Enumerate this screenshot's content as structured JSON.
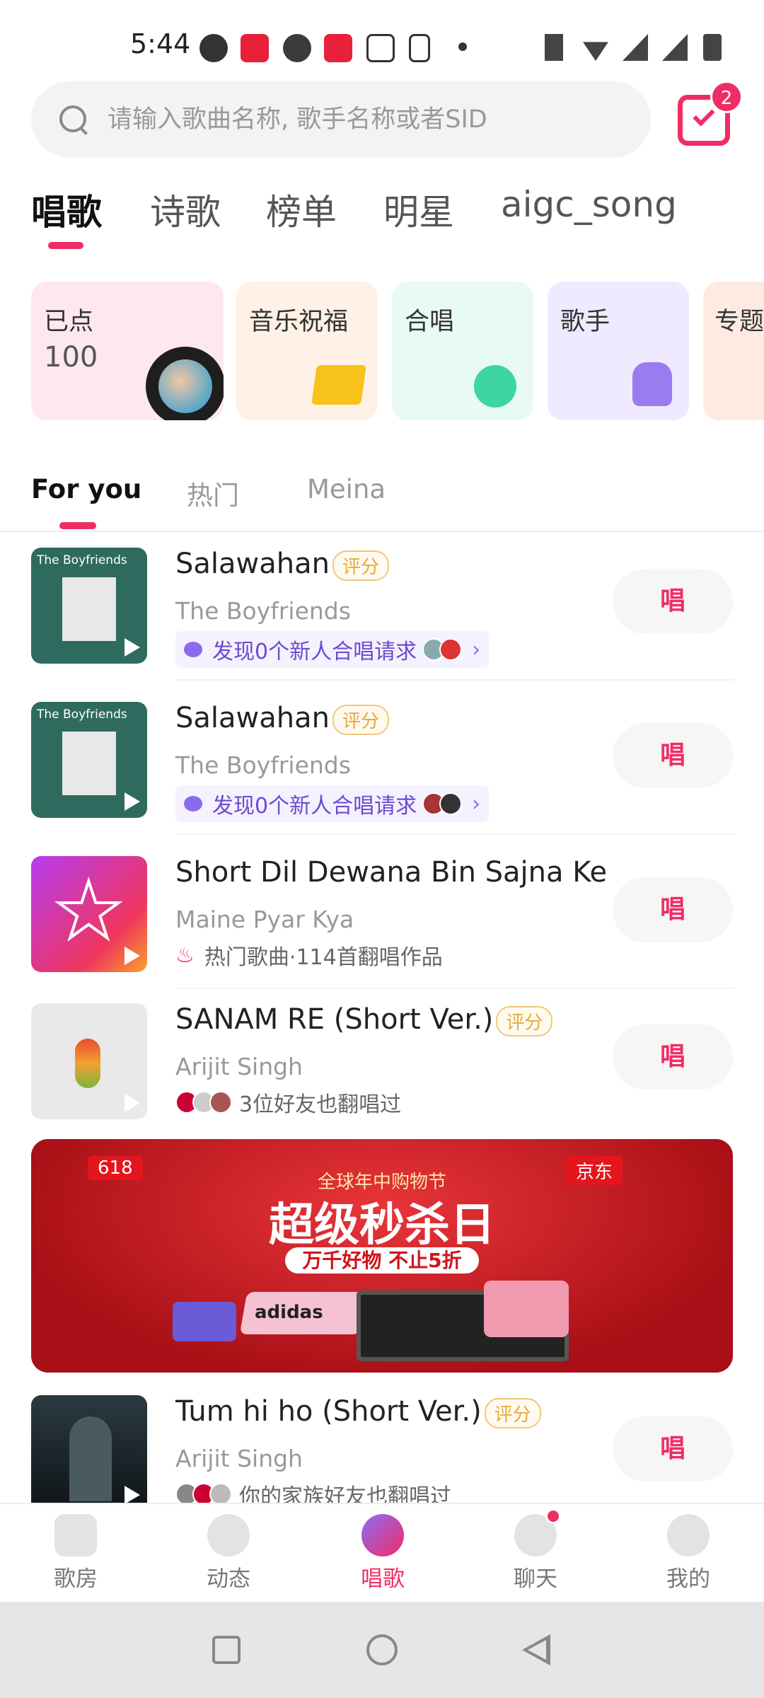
{
  "status_bar": {
    "time": "5:44"
  },
  "search": {
    "placeholder": "请输入歌曲名称, 歌手名称或者SID"
  },
  "calendar_badge": "2",
  "top_tabs": [
    "唱歌",
    "诗歌",
    "榜单",
    "明星",
    "aigc_song"
  ],
  "categories": [
    {
      "label": "已点",
      "count": "100"
    },
    {
      "label": "音乐祝福"
    },
    {
      "label": "合唱"
    },
    {
      "label": "歌手"
    },
    {
      "label": "专题"
    }
  ],
  "sub_tabs": [
    "For you",
    "热门",
    "Meina"
  ],
  "songs": [
    {
      "title": "Salawahan",
      "rating_badge": "评分",
      "artist": "The Boyfriends",
      "meta": "发现0个新人合唱请求",
      "sing": "唱",
      "cover_text": "The Boyfriends"
    },
    {
      "title": "Salawahan",
      "rating_badge": "评分",
      "artist": "The Boyfriends",
      "meta": "发现0个新人合唱请求",
      "sing": "唱",
      "cover_text": "The Boyfriends"
    },
    {
      "title": "Short Dil Dewana Bin Sajna Ke",
      "artist": "Maine Pyar Kya",
      "meta": "热门歌曲·114首翻唱作品",
      "sing": "唱"
    },
    {
      "title": "SANAM RE (Short Ver.)",
      "rating_badge": "评分",
      "artist": "Arijit Singh",
      "meta": "3位好友也翻唱过",
      "sing": "唱"
    },
    {
      "title": "Tum hi ho (Short Ver.)",
      "rating_badge": "评分",
      "artist": "Arijit Singh",
      "meta": "你的家族好友也翻唱过",
      "sing": "唱"
    }
  ],
  "banner": {
    "tag": "618",
    "line1": "全球年中购物节",
    "headline": "超级秒杀日",
    "subline": "万千好物 不止5折",
    "brand": "adidas",
    "store": "京东"
  },
  "bottom_nav": [
    "歌房",
    "动态",
    "唱歌",
    "聊天",
    "我的"
  ],
  "colors": {
    "accent": "#ef2d65",
    "purple_tag": "#6b4bd1",
    "rating": "#e8a93a"
  }
}
